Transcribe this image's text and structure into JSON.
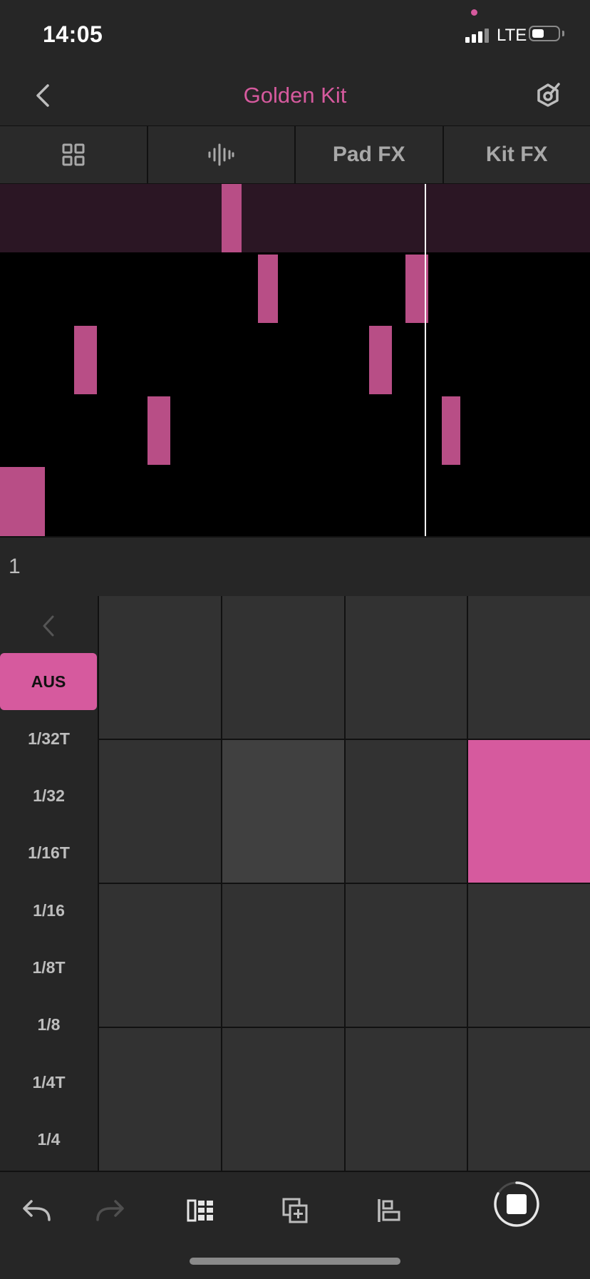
{
  "status": {
    "time": "14:05",
    "network": "LTE"
  },
  "header": {
    "title": "Golden Kit"
  },
  "tabs": [
    {
      "icon": "grid-icon"
    },
    {
      "icon": "waveform-icon"
    },
    {
      "label": "Pad FX"
    },
    {
      "label": "Kit FX"
    }
  ],
  "step": {
    "number": "1"
  },
  "quantize": {
    "options": [
      "AUS",
      "1/32T",
      "1/32",
      "1/16T",
      "1/16",
      "1/8T",
      "1/8",
      "1/4T",
      "1/4"
    ],
    "selected": "AUS"
  },
  "pads": {
    "rows": 4,
    "cols": 4,
    "lit": [
      [
        1,
        3
      ]
    ],
    "highlighted": [
      [
        1,
        1
      ]
    ]
  },
  "colors": {
    "accent": "#d65a9e",
    "note": "#b84e86",
    "background": "#262626",
    "roll_background": "#000000"
  },
  "toolbar": {
    "icons": [
      "undo-icon",
      "redo-icon",
      "sequencer-icon",
      "duplicate-icon",
      "align-icon",
      "stop-icon"
    ]
  }
}
